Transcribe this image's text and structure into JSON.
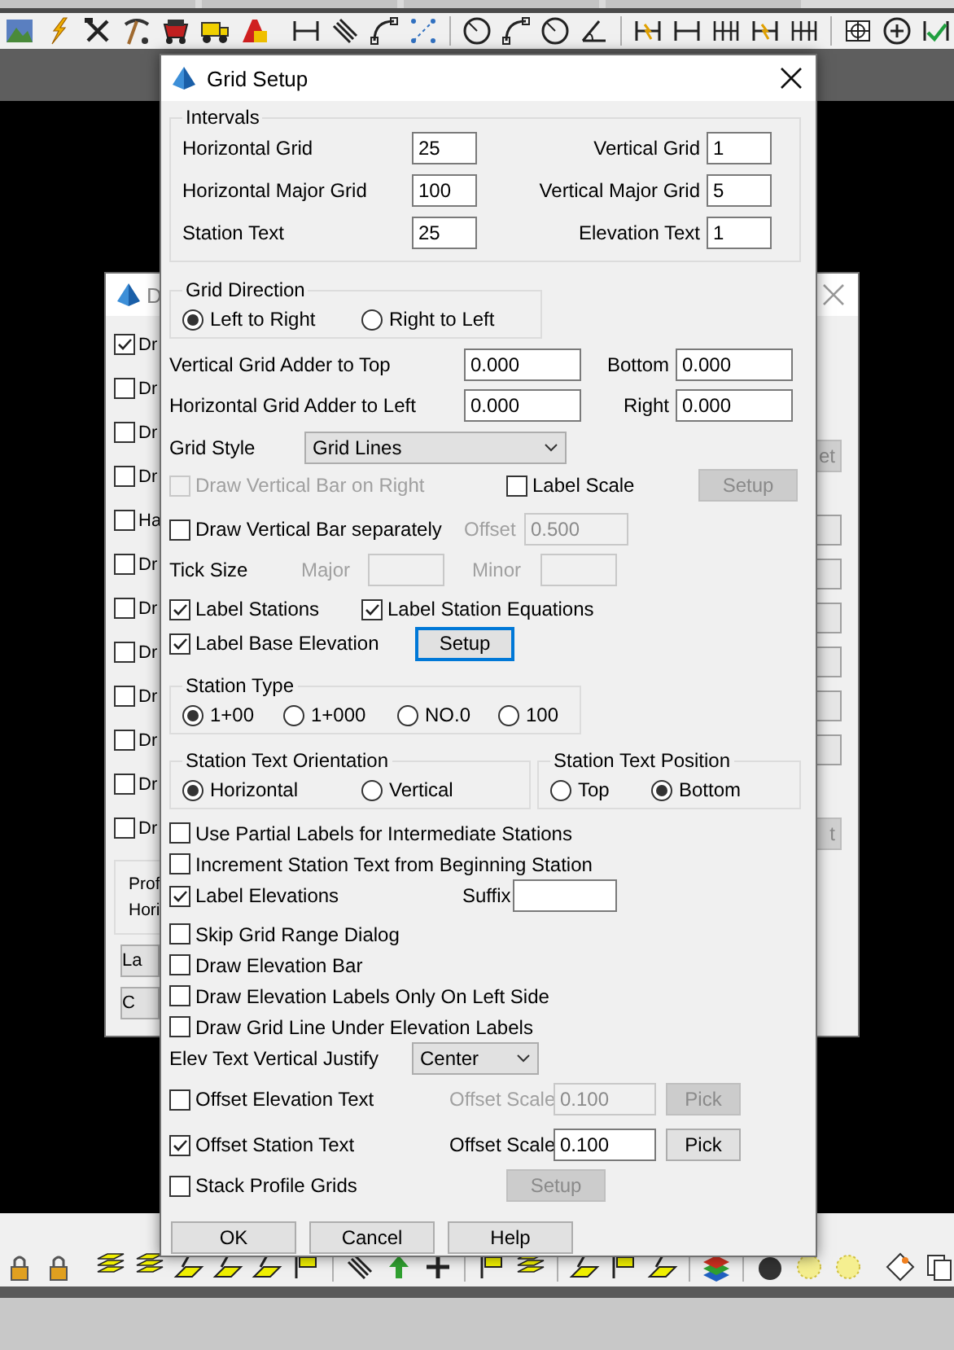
{
  "background_dialog": {
    "title": "D",
    "checkboxes": [
      {
        "label": "Dr",
        "checked": true
      },
      {
        "label": "Dr",
        "checked": false
      },
      {
        "label": "Dr",
        "checked": false
      },
      {
        "label": "Dr",
        "checked": false
      },
      {
        "label": "Ha",
        "checked": false
      },
      {
        "label": "Dr",
        "checked": false
      },
      {
        "label": "Dr",
        "checked": false
      },
      {
        "label": "Dr",
        "checked": false
      },
      {
        "label": "Dr",
        "checked": false
      },
      {
        "label": "Dr",
        "checked": false
      },
      {
        "label": "Dr",
        "checked": false
      },
      {
        "label": "Dr",
        "checked": false
      }
    ],
    "group_lines": [
      "Prof",
      "Hori"
    ],
    "buttons": [
      "La",
      "C"
    ],
    "side_buttons": [
      "et",
      "t"
    ]
  },
  "dialog": {
    "title": "Grid Setup",
    "intervals": {
      "title": "Intervals",
      "fields": [
        {
          "label": "Horizontal Grid",
          "value": "25"
        },
        {
          "label": "Vertical Grid",
          "value": "1"
        },
        {
          "label": "Horizontal Major Grid",
          "value": "100"
        },
        {
          "label": "Vertical Major Grid",
          "value": "5"
        },
        {
          "label": "Station Text",
          "value": "25"
        },
        {
          "label": "Elevation Text",
          "value": "1"
        }
      ]
    },
    "grid_direction": {
      "title": "Grid Direction",
      "options": [
        {
          "label": "Left to Right",
          "selected": true
        },
        {
          "label": "Right to Left",
          "selected": false
        }
      ]
    },
    "adders": [
      {
        "label": "Vertical Grid Adder to Top",
        "value": "0.000",
        "side_label": "Bottom",
        "side_value": "0.000"
      },
      {
        "label": "Horizontal Grid Adder to Left",
        "value": "0.000",
        "side_label": "Right",
        "side_value": "0.000"
      }
    ],
    "grid_style": {
      "label": "Grid Style",
      "value": "Grid Lines"
    },
    "vertical_bar_right": {
      "label": "Draw Vertical Bar on Right",
      "checked": false,
      "disabled": true
    },
    "label_scale": {
      "label": "Label Scale",
      "checked": false
    },
    "scale_setup_button": {
      "label": "Setup",
      "disabled": true
    },
    "vertical_bar_separately": {
      "label": "Draw Vertical Bar separately",
      "checked": false
    },
    "bar_offset": {
      "label": "Offset",
      "value": "0.500",
      "disabled": true
    },
    "tick_size": {
      "label": "Tick Size",
      "major_label": "Major",
      "minor_label": "Minor",
      "disabled": true
    },
    "label_stations": {
      "label": "Label Stations",
      "checked": true
    },
    "label_station_equations": {
      "label": "Label Station Equations",
      "checked": true
    },
    "label_base_elevation": {
      "label": "Label Base Elevation",
      "checked": true
    },
    "elevation_setup_button": {
      "label": "Setup",
      "focused": true
    },
    "station_type": {
      "title": "Station Type",
      "options": [
        {
          "label": "1+00",
          "selected": true
        },
        {
          "label": "1+000",
          "selected": false
        },
        {
          "label": "NO.0",
          "selected": false
        },
        {
          "label": "100",
          "selected": false
        }
      ]
    },
    "station_text_orientation": {
      "title": "Station Text Orientation",
      "options": [
        {
          "label": "Horizontal",
          "selected": true
        },
        {
          "label": "Vertical",
          "selected": false
        }
      ]
    },
    "station_text_position": {
      "title": "Station Text Position",
      "options": [
        {
          "label": "Top",
          "selected": false
        },
        {
          "label": "Bottom",
          "selected": true
        }
      ]
    },
    "options": [
      {
        "label": "Use Partial Labels for Intermediate Stations",
        "checked": false
      },
      {
        "label": "Increment Station Text from Beginning Station",
        "checked": false
      },
      {
        "label": "Label Elevations",
        "checked": true
      },
      {
        "label": "Skip Grid Range Dialog",
        "checked": false
      },
      {
        "label": "Draw Elevation Bar",
        "checked": false
      },
      {
        "label": "Draw Elevation Labels Only On Left Side",
        "checked": false
      },
      {
        "label": "Draw Grid Line Under Elevation Labels",
        "checked": false
      }
    ],
    "suffix": {
      "label": "Suffix"
    },
    "elev_justify": {
      "label": "Elev Text Vertical Justify",
      "value": "Center"
    },
    "offset_elevation_text": {
      "label": "Offset Elevation Text",
      "checked": false,
      "scale_label": "Offset Scale",
      "scale_value": "0.100",
      "pick_label": "Pick",
      "disabled": true
    },
    "offset_station_text": {
      "label": "Offset Station Text",
      "checked": true,
      "scale_label": "Offset Scale",
      "scale_value": "0.100",
      "pick_label": "Pick",
      "disabled": false
    },
    "stack_profile_grids": {
      "label": "Stack Profile Grids",
      "checked": false,
      "setup_label": "Setup",
      "setup_disabled": true
    },
    "buttons": [
      "OK",
      "Cancel",
      "Help"
    ]
  }
}
